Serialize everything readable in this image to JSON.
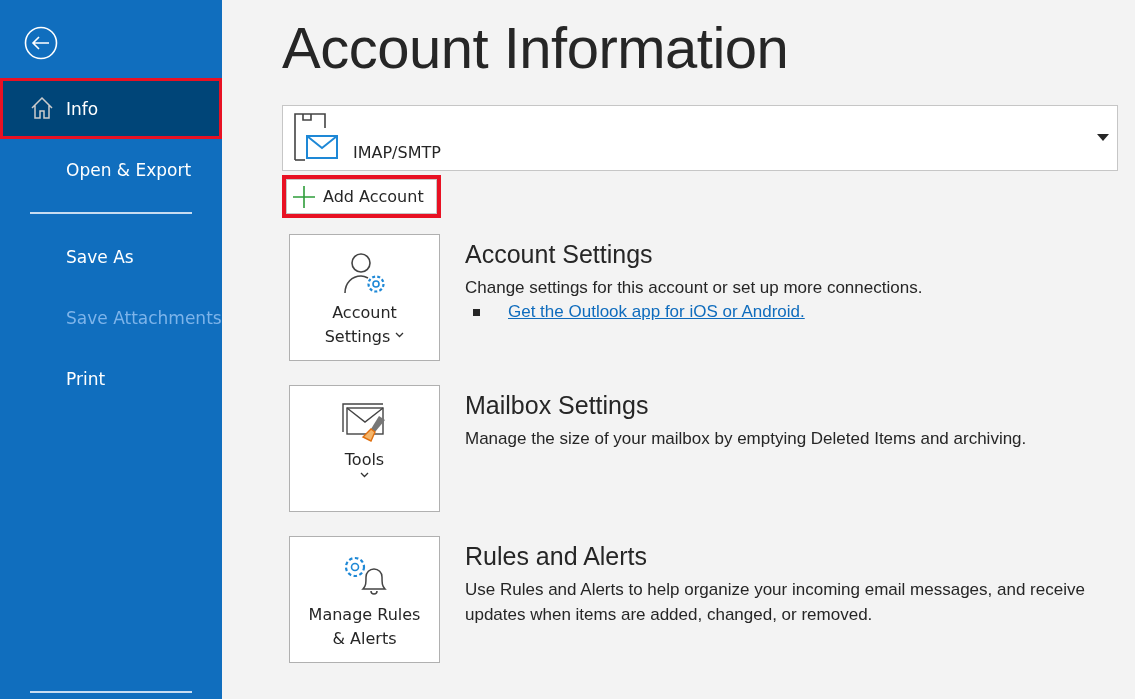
{
  "sidebar": {
    "items": [
      {
        "label": "Info",
        "selected": true,
        "disabled": false,
        "highlighted": true
      },
      {
        "label": "Open & Export",
        "selected": false,
        "disabled": false,
        "highlighted": false
      },
      {
        "kind": "divider"
      },
      {
        "label": "Save As",
        "selected": false,
        "disabled": false,
        "highlighted": false
      },
      {
        "label": "Save Attachments",
        "selected": false,
        "disabled": true,
        "highlighted": false
      },
      {
        "label": "Print",
        "selected": false,
        "disabled": false,
        "highlighted": false
      }
    ]
  },
  "title": "Account Information",
  "account_dropdown": {
    "value": "IMAP/SMTP"
  },
  "add_account": {
    "label": "Add Account",
    "highlighted": true
  },
  "sections": [
    {
      "button_lines": [
        "Account",
        "Settings"
      ],
      "kind": "account",
      "heading": "Account Settings",
      "description": "Change settings for this account or set up more connections.",
      "links": [
        "Get the Outlook app for iOS or Android."
      ]
    },
    {
      "button_lines": [
        "Tools"
      ],
      "kind": "tools",
      "heading": "Mailbox Settings",
      "description": "Manage the size of your mailbox by emptying Deleted Items and archiving."
    },
    {
      "button_lines": [
        "Manage Rules",
        "& Alerts"
      ],
      "kind": "rules",
      "heading": "Rules and Alerts",
      "description": "Use Rules and Alerts to help organize your incoming email messages, and receive updates when items are added, changed, or removed."
    }
  ]
}
